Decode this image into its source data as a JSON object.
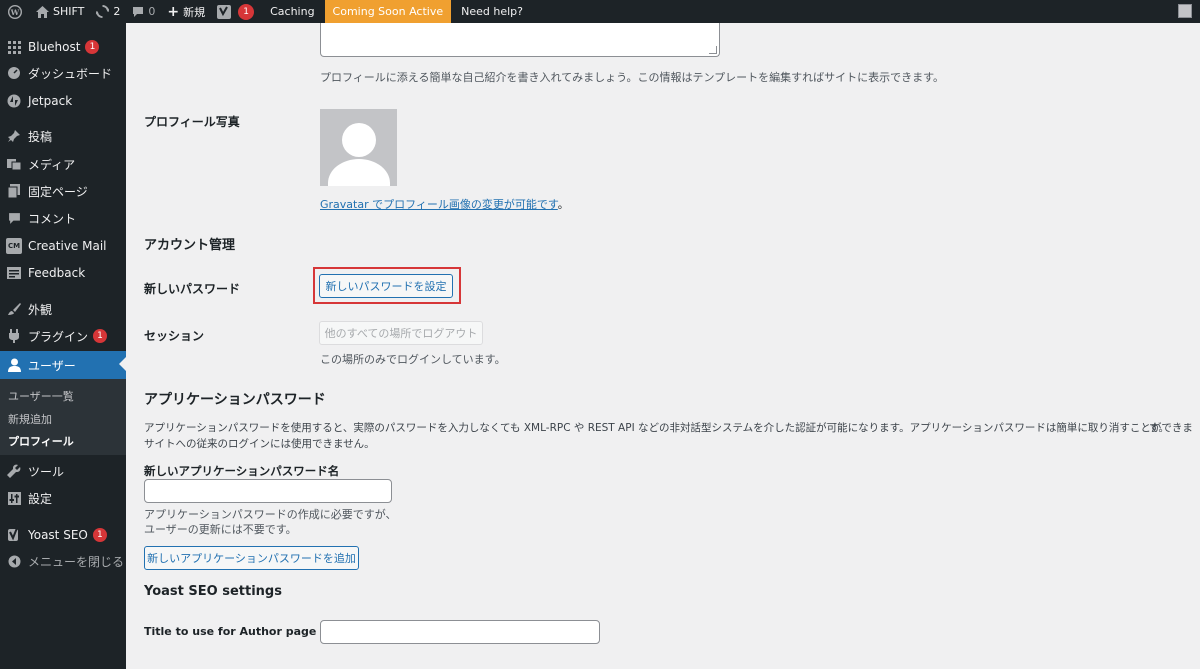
{
  "adminbar": {
    "site_name": "SHIFT",
    "updates_count": "2",
    "comments_count": "0",
    "new_label": "新規",
    "yoast_count": "1",
    "caching": "Caching",
    "coming_soon": "Coming Soon Active",
    "help": "Need help?"
  },
  "sidebar": {
    "items": [
      {
        "label": "Bluehost",
        "icon": "grid-icon",
        "badge": "1"
      },
      {
        "label": "ダッシュボード",
        "icon": "dashboard-icon"
      },
      {
        "label": "Jetpack",
        "icon": "jetpack-icon"
      },
      {
        "label": "投稿",
        "icon": "pin-icon"
      },
      {
        "label": "メディア",
        "icon": "media-icon"
      },
      {
        "label": "固定ページ",
        "icon": "page-icon"
      },
      {
        "label": "コメント",
        "icon": "comment-icon"
      },
      {
        "label": "Creative Mail",
        "icon": "cm-icon",
        "icon_text": "CM"
      },
      {
        "label": "Feedback",
        "icon": "feedback-icon"
      },
      {
        "label": "外観",
        "icon": "brush-icon"
      },
      {
        "label": "プラグイン",
        "icon": "plugin-icon",
        "badge": "1"
      },
      {
        "label": "ユーザー",
        "icon": "user-icon"
      }
    ],
    "submenu": [
      {
        "label": "ユーザー一覧"
      },
      {
        "label": "新規追加"
      },
      {
        "label": "プロフィール"
      }
    ],
    "bottom_items": [
      {
        "label": "ツール",
        "icon": "wrench-icon"
      },
      {
        "label": "設定",
        "icon": "settings-icon"
      },
      {
        "label": "Yoast SEO",
        "icon": "yoast-icon",
        "badge": "1"
      },
      {
        "label": "メニューを閉じる",
        "icon": "collapse-icon"
      }
    ]
  },
  "main": {
    "bio_description": "プロフィールに添える簡単な自己紹介を書き入れてみましょう。この情報はテンプレートを編集すればサイトに表示できます。",
    "profile_photo_label": "プロフィール写真",
    "gravatar_link": "Gravatar でプロフィール画像の変更が可能です",
    "gravatar_period": "。",
    "account_heading": "アカウント管理",
    "new_password_label": "新しいパスワード",
    "set_password_button": "新しいパスワードを設定",
    "session_label": "セッション",
    "logout_everywhere_button": "他のすべての場所でログアウト",
    "session_description": "この場所のみでログインしています。",
    "app_password_heading": "アプリケーションパスワード",
    "app_password_desc_1": "アプリケーションパスワードを使用すると、実際のパスワードを入力しなくても XML-RPC や REST API などの非対話型システムを介した認証が可能になります。アプリケーションパスワードは簡単に取り消すことができま",
    "app_password_desc_1b": "す。",
    "app_password_desc_2": "サイトへの従来のログインには使用できません。",
    "new_app_password_name_label": "新しいアプリケーションパスワード名",
    "app_name_help_1": "アプリケーションパスワードの作成に必要ですが、",
    "app_name_help_2": "ユーザーの更新には不要です。",
    "add_app_password_button": "新しいアプリケーションパスワードを追加",
    "yoast_heading": "Yoast SEO settings",
    "author_title_label": "Title to use for Author page"
  },
  "colors": {
    "admin_dark": "#1d2327",
    "accent_blue": "#2271b1",
    "badge_red": "#d63638",
    "coming_soon_orange": "#f0a030",
    "highlight_red": "#d63638"
  }
}
